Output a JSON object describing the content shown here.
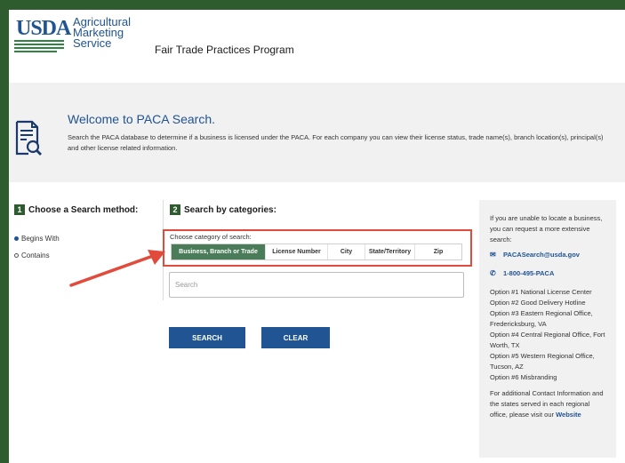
{
  "header": {
    "logo_text": "USDA",
    "agency_lines": [
      "Agricultural",
      "Marketing",
      "Service"
    ],
    "program": "Fair Trade Practices Program"
  },
  "welcome": {
    "title": "Welcome to PACA Search.",
    "text": "Search the PACA database to determine if a business is licensed under the PACA. For each company you can view their license status, trade name(s), branch location(s), principal(s) and other license related information."
  },
  "step1": {
    "num": "1",
    "label": "Choose a Search method:",
    "options": [
      {
        "label": "Begins With",
        "selected": true
      },
      {
        "label": "Contains",
        "selected": false
      }
    ]
  },
  "step2": {
    "num": "2",
    "label": "Search by categories:",
    "caption": "Choose category of search:",
    "tabs": [
      {
        "label": "Business, Branch or Trade",
        "active": true
      },
      {
        "label": "License Number",
        "active": false
      },
      {
        "label": "City",
        "active": false
      },
      {
        "label": "State/Territory",
        "active": false
      },
      {
        "label": "Zip",
        "active": false
      }
    ],
    "search_placeholder": "Search",
    "search_button": "SEARCH",
    "clear_button": "CLEAR"
  },
  "side": {
    "intro": "If you are unable to locate a business, you can request a more extensive search:",
    "email": "PACASearch@usda.gov",
    "phone": "1-800-495-PACA",
    "options": [
      "Option #1 National License Center",
      "Option #2 Good Delivery Hotline",
      "Option #3 Eastern Regional Office, Fredericksburg, VA",
      "Option #4 Central Regional Office, Fort Worth, TX",
      "Option #5 Western Regional Office, Tucson, AZ",
      "Option #6 Misbranding"
    ],
    "footer": "For additional Contact Information and the states served in each regional office, please visit our",
    "website_link": "Website"
  },
  "colors": {
    "frame": "#2e5c2e",
    "brand_blue": "#205493",
    "active_tab": "#4a7c59",
    "highlight": "#e24a3b"
  }
}
